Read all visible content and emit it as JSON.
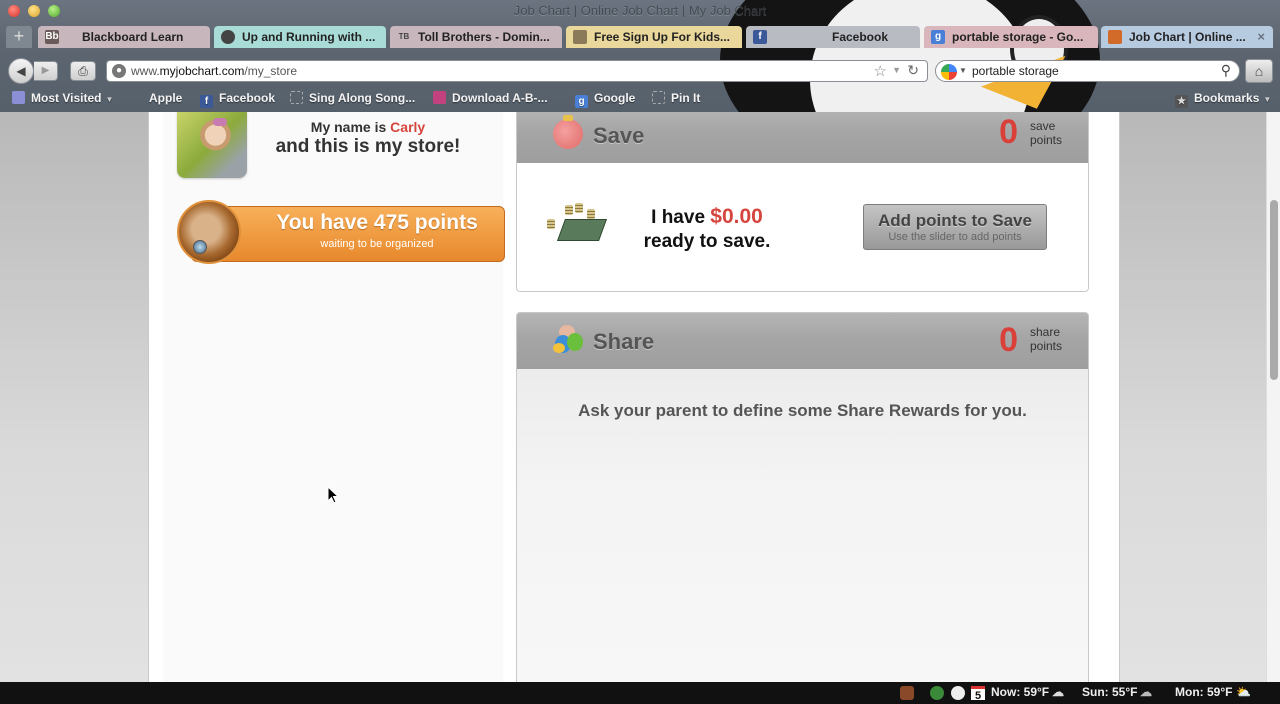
{
  "window": {
    "title": "Job Chart | Online Job Chart | My Job Chart"
  },
  "tabs": [
    {
      "label": "Blackboard Learn",
      "favicon": "blackboard-icon",
      "color": "#c7b6bb",
      "active": false
    },
    {
      "label": "Up and Running with ...",
      "favicon": "lynda-icon",
      "color": "#a9dcd6",
      "active": false
    },
    {
      "label": "Toll Brothers - Domin...",
      "favicon": "toll-brothers-icon",
      "color": "#c7b6bb",
      "active": false
    },
    {
      "label": "Free Sign Up For Kids...",
      "favicon": "jobchart-icon",
      "color": "#ead79b",
      "active": false
    },
    {
      "label": "Facebook",
      "favicon": "facebook-icon",
      "color": "#b8bcc2",
      "active": false
    },
    {
      "label": "portable storage - Go...",
      "favicon": "google-icon",
      "color": "#d8b6bb",
      "active": false
    },
    {
      "label": "Job Chart | Online ...",
      "favicon": "jobchart-icon",
      "color": "#b7cbe0",
      "active": true
    }
  ],
  "newtab_label": "+",
  "tab_close_glyph": "×",
  "navbar": {
    "url_prefix": "www.",
    "url_domain": "myjobchart.com",
    "url_path": "/my_store",
    "search_query": "portable storage"
  },
  "bookmarks": [
    {
      "label": "Most Visited",
      "icon": "most-visited-icon",
      "dropdown": true
    },
    {
      "label": "Apple",
      "icon": "apple-icon"
    },
    {
      "label": "Facebook",
      "icon": "facebook-icon"
    },
    {
      "label": "Sing Along Song...",
      "icon": "page-icon"
    },
    {
      "label": "Download A-B-...",
      "icon": "download-icon"
    },
    {
      "label": "Google",
      "icon": "google-icon"
    },
    {
      "label": "Pin It",
      "icon": "pin-icon"
    }
  ],
  "bookmarks_menu_label": "Bookmarks",
  "store": {
    "name_prefix": "My name is ",
    "kid_name": "Carly",
    "store_line": "and this is my store!",
    "points_title": "You have 475 points",
    "points_value": 475,
    "points_sub": "waiting to be organized"
  },
  "save_panel": {
    "title": "Save",
    "points": "0",
    "points_label_1": "save",
    "points_label_2": "points",
    "have_prefix": "I have ",
    "amount": "$0.00",
    "ready_line": "ready to save.",
    "button_main": "Add points to Save",
    "button_sub": "Use the slider to add points"
  },
  "share_panel": {
    "title": "Share",
    "points": "0",
    "points_label_1": "share",
    "points_label_2": "points",
    "message": "Ask your parent to define some Share Rewards for you."
  },
  "status_bar": {
    "calendar_day": "5",
    "now": "Now: 59°F",
    "sun": "Sun: 55°F",
    "mon": "Mon: 59°F"
  },
  "colors": {
    "accent_red": "#d6453d",
    "points_orange": "#e8882c",
    "panel_header_gray": "#a5a5a5"
  }
}
